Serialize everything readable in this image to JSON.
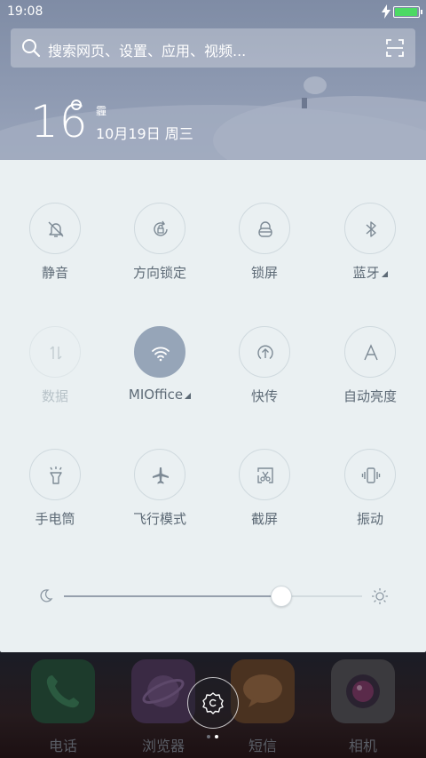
{
  "status_bar": {
    "time": "19:08",
    "battery_level": 0.95
  },
  "search": {
    "placeholder": "搜索网页、设置、应用、视频..."
  },
  "weather": {
    "temperature": "16",
    "condition": "霾",
    "date": "10月19日 周三"
  },
  "toggles": [
    {
      "label": "静音",
      "icon": "silent-bell-icon",
      "state": "off"
    },
    {
      "label": "方向锁定",
      "icon": "rotation-lock-icon",
      "state": "off"
    },
    {
      "label": "锁屏",
      "icon": "lock-icon",
      "state": "off"
    },
    {
      "label": "蓝牙",
      "icon": "bluetooth-icon",
      "state": "off",
      "has_menu": true
    },
    {
      "label": "数据",
      "icon": "mobile-data-icon",
      "state": "disabled"
    },
    {
      "label": "MIOffice",
      "icon": "wifi-icon",
      "state": "on",
      "has_menu": true
    },
    {
      "label": "快传",
      "icon": "quick-transfer-icon",
      "state": "off"
    },
    {
      "label": "自动亮度",
      "icon": "auto-brightness-icon",
      "state": "off"
    },
    {
      "label": "手电筒",
      "icon": "flashlight-icon",
      "state": "off"
    },
    {
      "label": "飞行模式",
      "icon": "airplane-icon",
      "state": "off"
    },
    {
      "label": "截屏",
      "icon": "screenshot-icon",
      "state": "off"
    },
    {
      "label": "振动",
      "icon": "vibrate-icon",
      "state": "off"
    }
  ],
  "brightness": {
    "level": 0.73
  },
  "dock": {
    "apps": [
      {
        "label": "电话",
        "icon": "phone-app-icon",
        "color": "#1d3b2c"
      },
      {
        "label": "浏览器",
        "icon": "browser-app-icon",
        "color": "#3a2a44"
      },
      {
        "label": "短信",
        "icon": "messages-app-icon",
        "color": "#4a3220"
      },
      {
        "label": "相机",
        "icon": "camera-app-icon",
        "color": "#3b3a3e"
      }
    ],
    "page_dots": 2,
    "current_page": 2
  },
  "colors": {
    "panel_bg": "#eaf0f2",
    "active_toggle": "#96a5b8",
    "label_text": "#5d6a76"
  }
}
